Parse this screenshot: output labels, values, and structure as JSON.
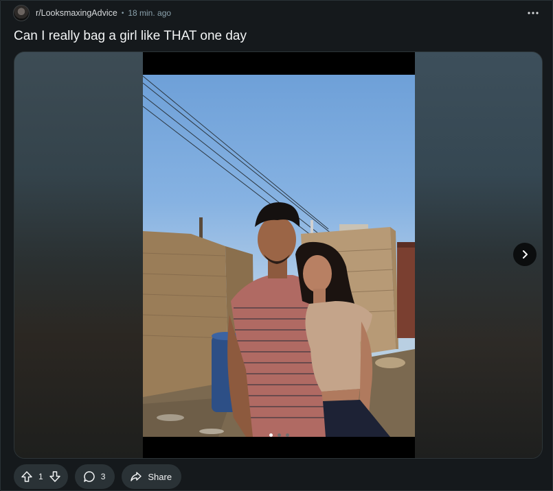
{
  "post": {
    "subreddit": "r/LooksmaxingAdvice",
    "separator": "•",
    "time": "18 min. ago",
    "title": "Can I really bag a girl like THAT one day"
  },
  "gallery": {
    "current_index": 1,
    "total": 3
  },
  "actions": {
    "vote_count": "1",
    "comment_count": "3",
    "share_label": "Share"
  },
  "icons": {
    "overflow": "more-horizontal-icon",
    "upvote": "arrow-up-icon",
    "downvote": "arrow-down-icon",
    "comment": "comment-bubble-icon",
    "share": "share-arrow-icon",
    "next": "chevron-right-icon"
  }
}
